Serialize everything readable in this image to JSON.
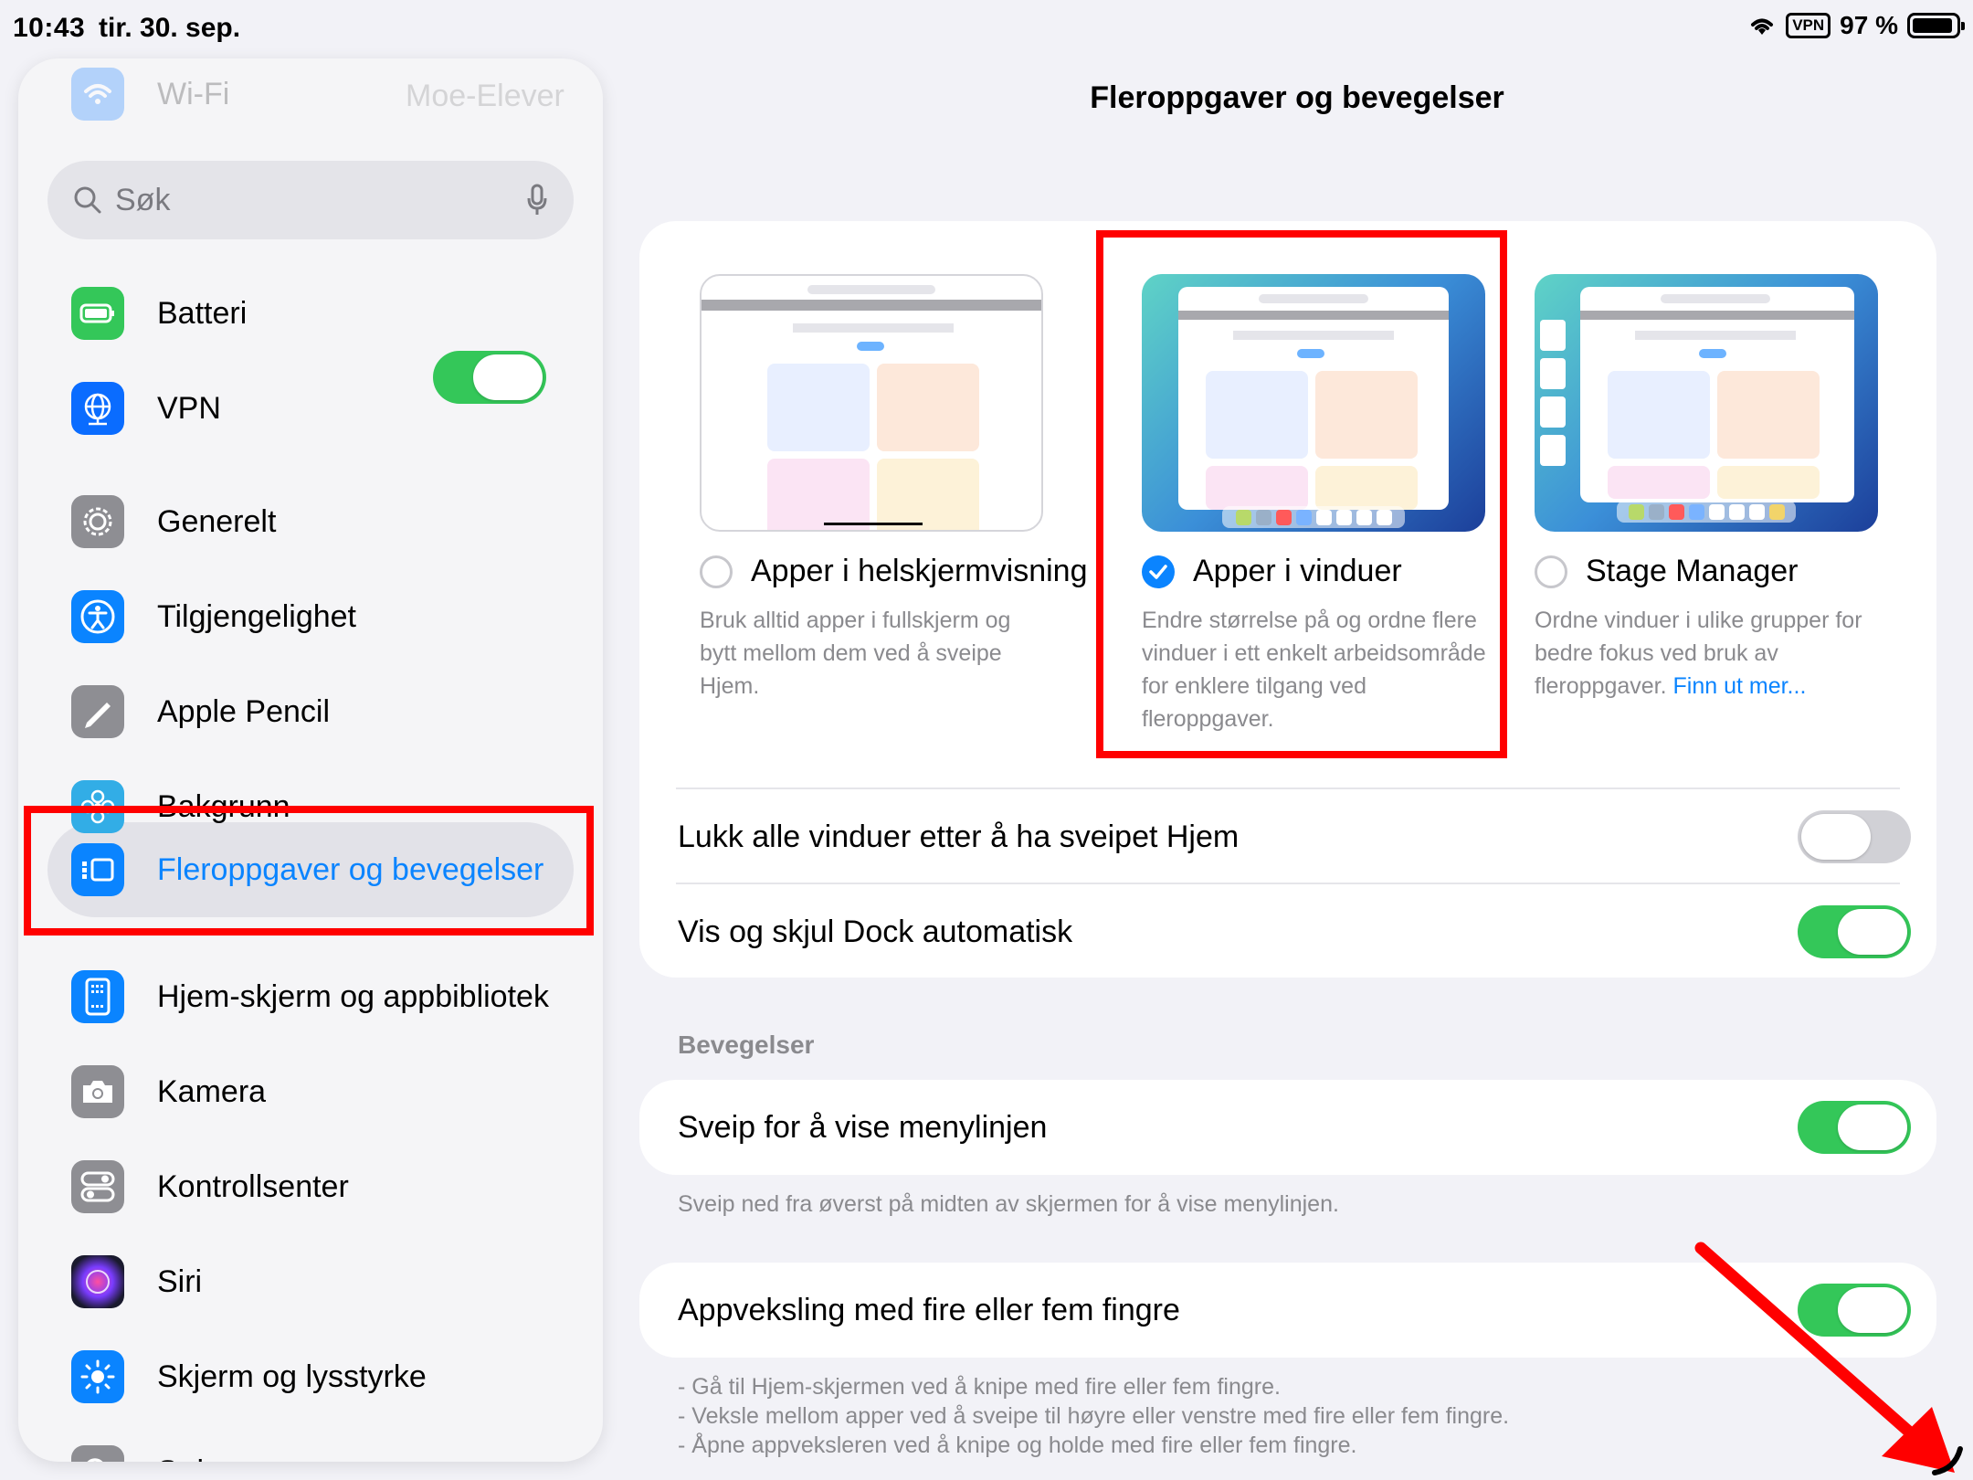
{
  "status_bar": {
    "time": "10:43",
    "date": "tir. 30. sep.",
    "vpn": "VPN",
    "battery": "97 %"
  },
  "sidebar": {
    "wifi": {
      "label": "Wi-Fi",
      "value": "Moe-Elever"
    },
    "search_placeholder": "Søk",
    "items": [
      {
        "label": "Batteri",
        "icon": "battery-icon"
      },
      {
        "label": "VPN",
        "icon": "vpn-globe-icon",
        "toggle": true
      },
      {
        "label": "Generelt",
        "icon": "gear-icon"
      },
      {
        "label": "Tilgjengelighet",
        "icon": "accessibility-icon"
      },
      {
        "label": "Apple Pencil",
        "icon": "pencil-icon"
      },
      {
        "label": "Bakgrunn",
        "icon": "flower-icon"
      },
      {
        "label": "Fleroppgaver og bevegelser",
        "icon": "multitasking-icon",
        "selected": true
      },
      {
        "label": "Hjem-skjerm og appbibliotek",
        "icon": "home-screen-icon"
      },
      {
        "label": "Kamera",
        "icon": "camera-icon"
      },
      {
        "label": "Kontrollsenter",
        "icon": "control-center-icon"
      },
      {
        "label": "Siri",
        "icon": "siri-icon"
      },
      {
        "label": "Skjerm og lysstyrke",
        "icon": "sun-icon"
      },
      {
        "label": "Søk",
        "icon": "search-icon"
      }
    ]
  },
  "main": {
    "title": "Fleroppgaver og bevegelser",
    "modes": [
      {
        "label": "Apper i helskjermvisning",
        "desc": "Bruk alltid apper i fullskjerm og bytt mellom dem ved å sveipe Hjem.",
        "checked": false
      },
      {
        "label": "Apper i vinduer",
        "desc": "Endre størrelse på og ordne flere vinduer i ett enkelt arbeidsområde for enklere tilgang ved fleroppgaver.",
        "checked": true
      },
      {
        "label": "Stage Manager",
        "desc": "Ordne vinduer i ulike grupper for bedre fokus ved bruk av fleroppgaver.",
        "link": "Finn ut mer...",
        "checked": false
      }
    ],
    "rows": [
      {
        "label": "Lukk alle vinduer etter å ha sveipet Hjem",
        "on": false
      },
      {
        "label": "Vis og skjul Dock automatisk",
        "on": true
      }
    ],
    "gestures_header": "Bevegelser",
    "gesture_rows": [
      {
        "label": "Sveip for å vise menylinjen",
        "on": true,
        "note": "Sveip ned fra øverst på midten av skjermen for å vise menylinjen."
      },
      {
        "label": "Appveksling med fire eller fem fingre",
        "on": true
      }
    ],
    "notes": [
      "- Gå til Hjem-skjermen ved å knipe med fire eller fem fingre.",
      "- Veksle mellom apper ved å sveipe til høyre eller venstre med fire eller fem fingre.",
      "- Åpne appveksleren ved å knipe og holde med fire eller fem fingre."
    ]
  },
  "colors": {
    "accent": "#0a84ff",
    "toggle_on": "#34c759",
    "annotation_red": "#ff0000"
  }
}
